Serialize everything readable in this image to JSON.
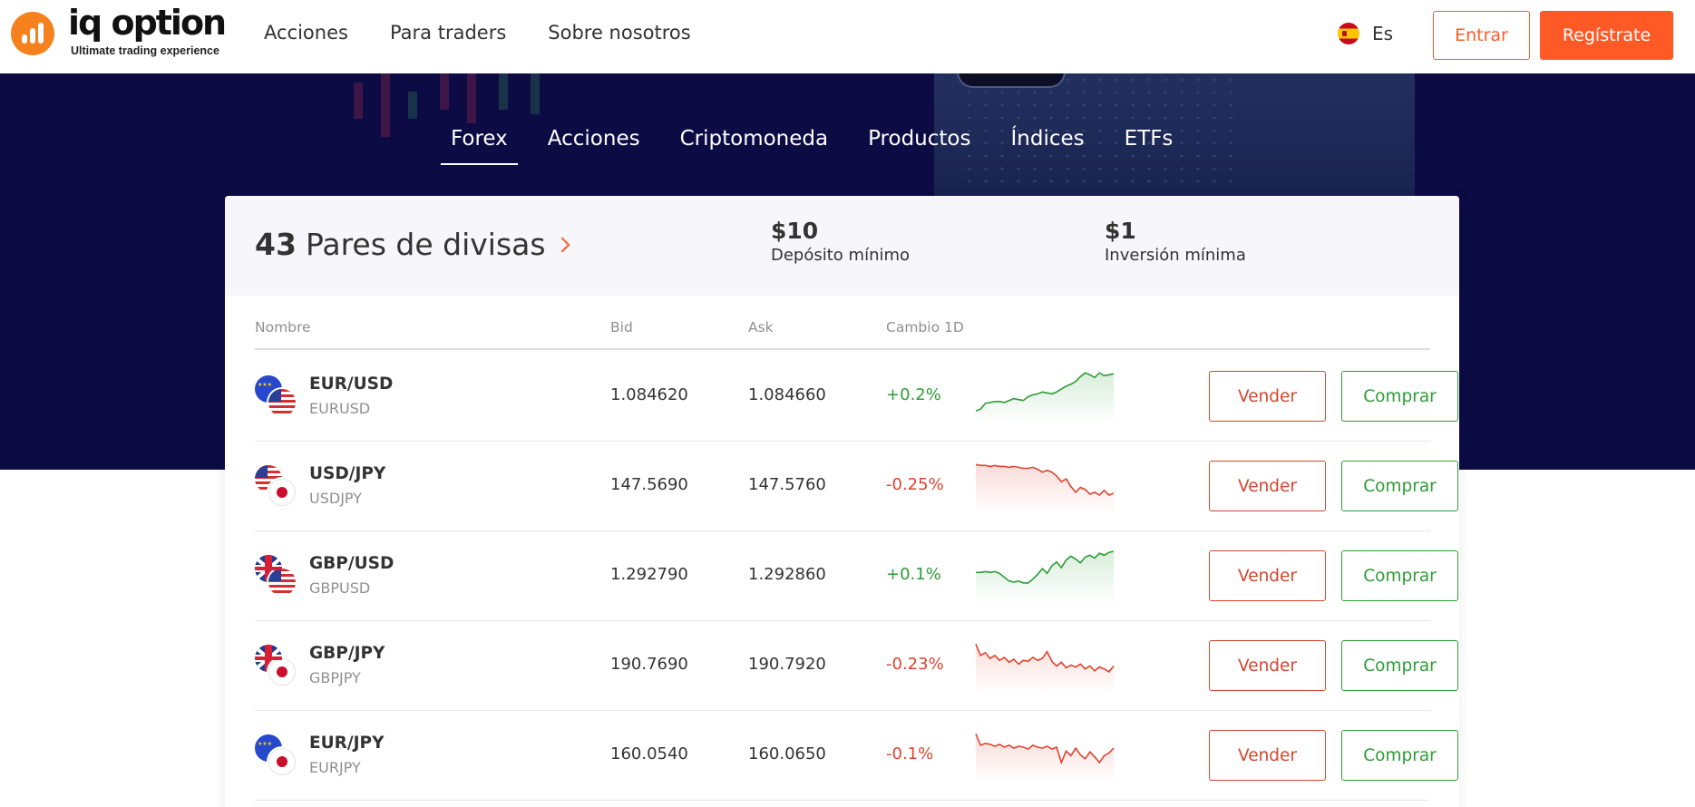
{
  "brand": {
    "name": "iq option",
    "tagline": "Ultimate trading experience",
    "color": "#f5821f"
  },
  "nav": {
    "items": [
      "Acciones",
      "Para traders",
      "Sobre nosotros"
    ]
  },
  "header": {
    "language": "Es",
    "language_flag": "spain-flag-icon",
    "login_label": "Entrar",
    "register_label": "Regístrate",
    "accent_color": "#ff5a25"
  },
  "tabs": {
    "items": [
      "Forex",
      "Acciones",
      "Criptomoneda",
      "Productos",
      "Índices",
      "ETFs"
    ],
    "active": "Forex"
  },
  "summary": {
    "count": "43",
    "label": "Pares de divisas",
    "min_deposit_value": "$10",
    "min_deposit_label": "Depósito mínimo",
    "min_investment_value": "$1",
    "min_investment_label": "Inversión mínima"
  },
  "table": {
    "headers": {
      "name": "Nombre",
      "bid": "Bid",
      "ask": "Ask",
      "change": "Cambio 1D"
    },
    "sell_label": "Vender",
    "buy_label": "Comprar",
    "up_color": "#2e9d35",
    "down_color": "#e0432d",
    "rows": [
      {
        "pair": "EUR/USD",
        "code": "EURUSD",
        "bid": "1.084620",
        "ask": "1.084660",
        "change": "+0.2%",
        "direction": "up",
        "flags": [
          "eu",
          "us"
        ],
        "trend": [
          12,
          14,
          20,
          21,
          22,
          22,
          21,
          23,
          25,
          24,
          23,
          27,
          29,
          30,
          32,
          31,
          30,
          32,
          35,
          38,
          40,
          43,
          48,
          52,
          50,
          47,
          52,
          49,
          50,
          51
        ]
      },
      {
        "pair": "USD/JPY",
        "code": "USDJPY",
        "bid": "147.5690",
        "ask": "147.5760",
        "change": "-0.25%",
        "direction": "down",
        "flags": [
          "us",
          "jp"
        ],
        "trend": [
          50,
          49,
          49,
          48,
          49,
          48,
          48,
          47,
          48,
          47,
          46,
          46,
          47,
          45,
          42,
          44,
          42,
          38,
          32,
          35,
          27,
          21,
          26,
          24,
          19,
          21,
          18,
          23,
          18,
          20
        ]
      },
      {
        "pair": "GBP/USD",
        "code": "GBPUSD",
        "bid": "1.292790",
        "ask": "1.292860",
        "change": "+0.1%",
        "direction": "up",
        "flags": [
          "gb",
          "us"
        ],
        "trend": [
          31,
          31,
          32,
          31,
          32,
          30,
          26,
          22,
          21,
          22,
          20,
          20,
          24,
          29,
          35,
          30,
          38,
          42,
          36,
          44,
          48,
          45,
          41,
          47,
          49,
          46,
          51,
          49,
          52,
          53
        ]
      },
      {
        "pair": "GBP/JPY",
        "code": "GBPJPY",
        "bid": "190.7690",
        "ask": "190.7920",
        "change": "-0.23%",
        "direction": "down",
        "flags": [
          "gb",
          "jp"
        ],
        "trend": [
          50,
          38,
          41,
          35,
          38,
          33,
          36,
          31,
          34,
          29,
          33,
          32,
          36,
          33,
          35,
          42,
          32,
          27,
          31,
          25,
          28,
          26,
          29,
          24,
          27,
          22,
          26,
          24,
          21,
          27
        ]
      },
      {
        "pair": "EUR/JPY",
        "code": "EURJPY",
        "bid": "160.0540",
        "ask": "160.0650",
        "change": "-0.1%",
        "direction": "down",
        "flags": [
          "eu",
          "jp"
        ],
        "trend": [
          50,
          38,
          40,
          39,
          37,
          39,
          36,
          38,
          35,
          37,
          36,
          34,
          38,
          36,
          35,
          37,
          34,
          36,
          20,
          32,
          27,
          35,
          28,
          24,
          31,
          26,
          20,
          27,
          30,
          35
        ]
      }
    ]
  }
}
